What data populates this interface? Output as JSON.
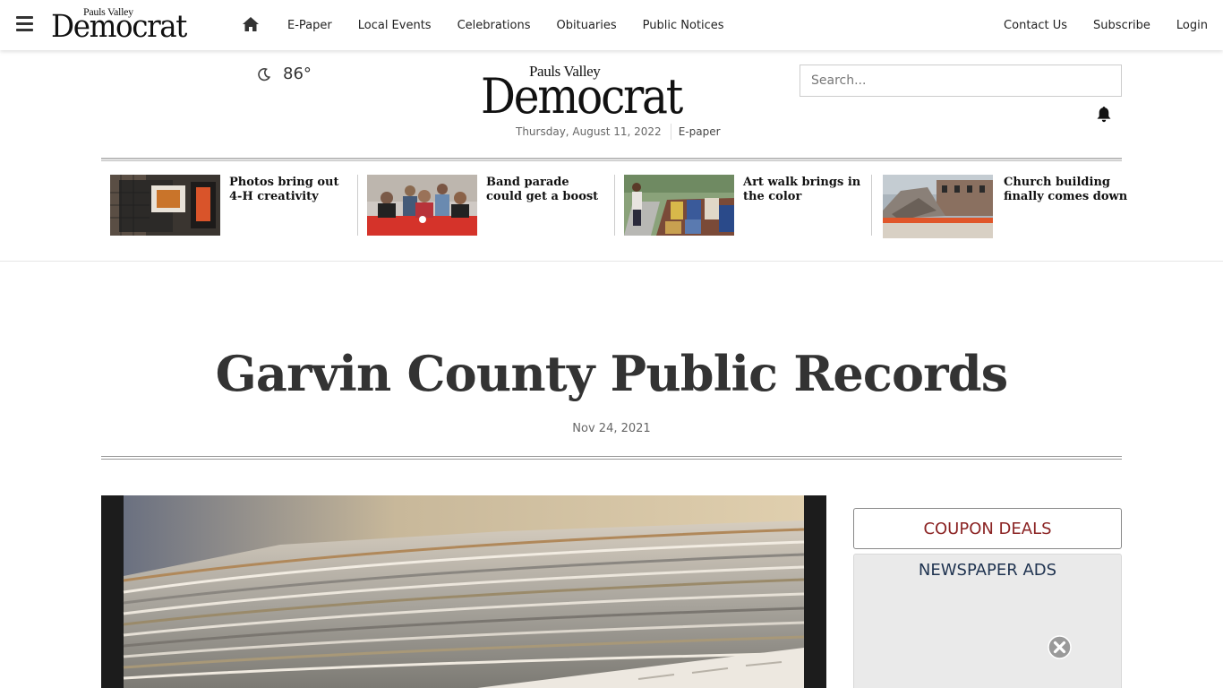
{
  "nav": {
    "logo_small_top": "Pauls Valley",
    "logo_small_main": "Democrat",
    "links": [
      "E-Paper",
      "Local Events",
      "Celebrations",
      "Obituaries",
      "Public Notices"
    ],
    "right_links": [
      "Contact Us",
      "Subscribe",
      "Login"
    ]
  },
  "header": {
    "weather_temp": "86°",
    "masthead_top": "Pauls Valley",
    "masthead_main": "Democrat",
    "date": "Thursday, August 11, 2022",
    "epaper_link": "E-paper",
    "search_placeholder": "Search..."
  },
  "headlines": [
    {
      "title": "Photos bring out 4-H creativity"
    },
    {
      "title": "Band parade could get a boost"
    },
    {
      "title": "Art walk brings in the color"
    },
    {
      "title": "Church building finally comes down"
    }
  ],
  "article": {
    "title": "Garvin County Public Records",
    "date": "Nov 24, 2021"
  },
  "sidebar": {
    "coupon_label": "COUPON DEALS",
    "ad_label": "NEWSPAPER ADS"
  },
  "colors": {
    "coupon_text": "#8b2323",
    "ad_label": "#1f3350"
  },
  "icons": [
    "menu-icon",
    "home-icon",
    "moon-icon",
    "bell-icon",
    "close-circle-icon"
  ]
}
